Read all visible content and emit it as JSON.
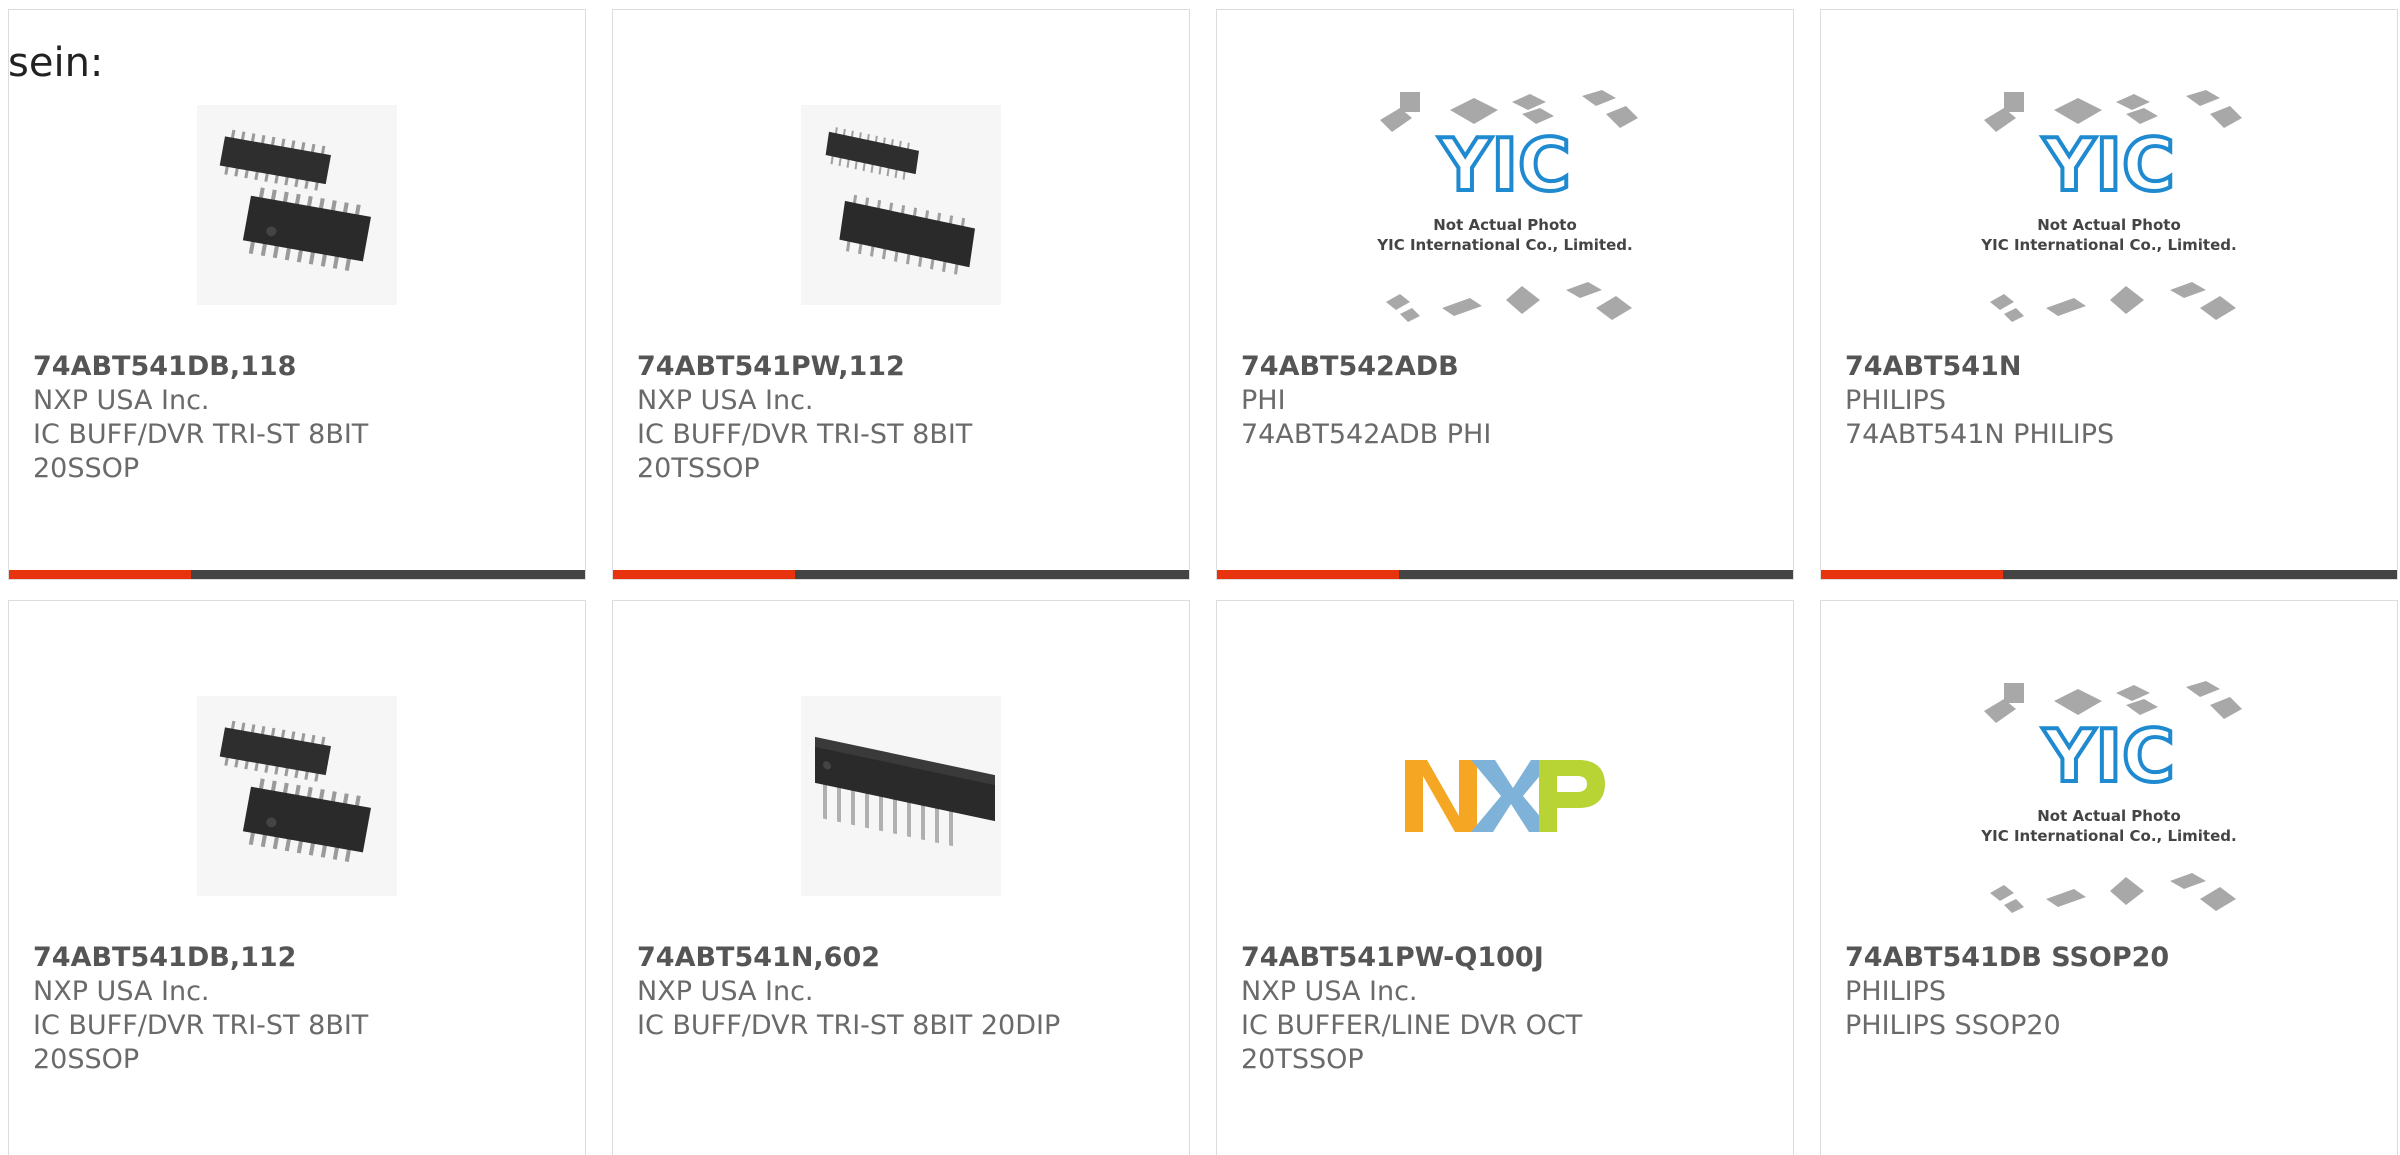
{
  "intro_text": "sein:",
  "colors": {
    "accent": "#e8340e",
    "bar": "#444444",
    "border": "#dcdcdc",
    "pn_text": "#555555",
    "body_text": "#6a6a6a"
  },
  "products": [
    {
      "part_number": "74ABT541DB,118",
      "manufacturer": "NXP USA Inc.",
      "description": "IC BUFF/DVR TRI-ST 8BIT 20SSOP",
      "image": "ssop-chip-icon"
    },
    {
      "part_number": "74ABT541PW,112",
      "manufacturer": "NXP USA Inc.",
      "description": "IC BUFF/DVR TRI-ST 8BIT 20TSSOP",
      "image": "tssop-chip-icon"
    },
    {
      "part_number": "74ABT542ADB",
      "manufacturer": "PHI",
      "description": "74ABT542ADB PHI",
      "image": "yic-placeholder-icon",
      "placeholder_line1": "Not Actual Photo",
      "placeholder_line2": "YIC International Co., Limited."
    },
    {
      "part_number": "74ABT541N",
      "manufacturer": "PHILIPS",
      "description": "74ABT541N PHILIPS",
      "image": "yic-placeholder-icon",
      "placeholder_line1": "Not Actual Photo",
      "placeholder_line2": "YIC International Co., Limited."
    },
    {
      "part_number": "74ABT541DB,112",
      "manufacturer": "NXP USA Inc.",
      "description": "IC BUFF/DVR TRI-ST 8BIT 20SSOP",
      "image": "ssop-chip-icon"
    },
    {
      "part_number": "74ABT541N,602",
      "manufacturer": "NXP USA Inc.",
      "description": "IC BUFF/DVR TRI-ST 8BIT 20DIP",
      "image": "dip-chip-icon"
    },
    {
      "part_number": "74ABT541PW-Q100J",
      "manufacturer": "NXP USA Inc.",
      "description": "IC BUFFER/LINE DVR OCT 20TSSOP",
      "image": "nxp-logo",
      "logo_text": "NXP"
    },
    {
      "part_number": "74ABT541DB SSOP20",
      "manufacturer": "PHILIPS",
      "description": "PHILIPS SSOP20",
      "image": "yic-placeholder-icon",
      "placeholder_line1": "Not Actual Photo",
      "placeholder_line2": "YIC International Co., Limited."
    }
  ]
}
